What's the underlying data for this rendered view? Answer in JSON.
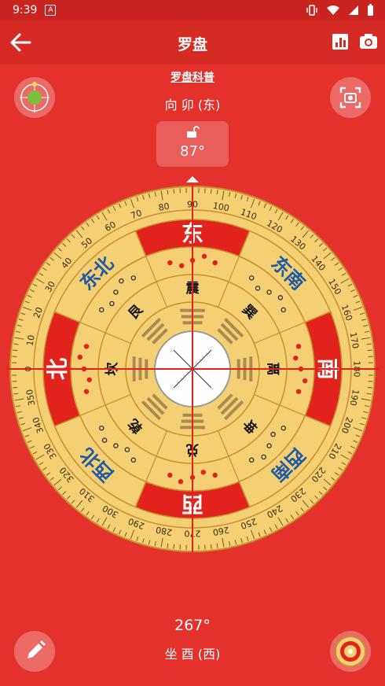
{
  "status": {
    "time": "9:39",
    "app_icon_letter": "A"
  },
  "appbar": {
    "title": "罗盘"
  },
  "link": "罗盘科普",
  "facing": "向 卯 (东)",
  "lock": {
    "degree": "87°"
  },
  "sitting": {
    "degree": "267°",
    "label": "坐 酉 (西)"
  },
  "compass": {
    "ring_labels": [
      "0",
      "10",
      "20",
      "30",
      "40",
      "50",
      "60",
      "70",
      "80",
      "90",
      "100",
      "110",
      "120",
      "130",
      "140",
      "150",
      "160",
      "170",
      "180",
      "190",
      "200",
      "210",
      "220",
      "230",
      "240",
      "250",
      "260",
      "270",
      "280",
      "290",
      "300",
      "310",
      "320",
      "330",
      "340",
      "350"
    ],
    "directions": [
      {
        "label": "东",
        "red": true
      },
      {
        "label": "东南",
        "red": false
      },
      {
        "label": "南",
        "red": true
      },
      {
        "label": "西南",
        "red": false
      },
      {
        "label": "西",
        "red": true
      },
      {
        "label": "西北",
        "red": false
      },
      {
        "label": "北",
        "red": true
      },
      {
        "label": "东北",
        "red": false
      }
    ],
    "trigrams": [
      "震",
      "巽",
      "离",
      "坤",
      "兑",
      "乾",
      "坎",
      "艮"
    ],
    "colors": {
      "ring": "#f4cf73",
      "ring_dark": "#c8902e",
      "red": "#e2231d",
      "blue": "#1f5ba5",
      "center": "#ffffff"
    }
  }
}
